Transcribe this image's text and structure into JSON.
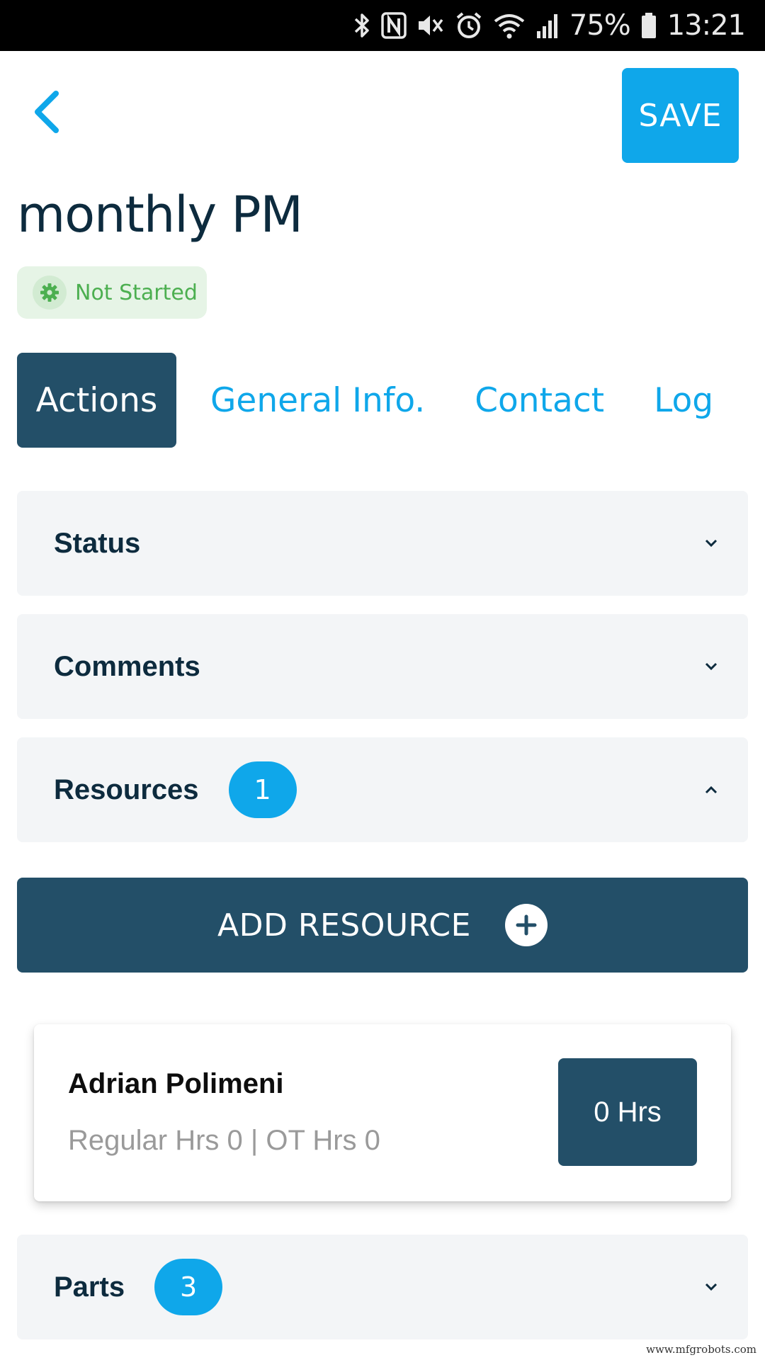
{
  "status_bar": {
    "battery_percent": "75%",
    "time": "13:21",
    "icons": [
      "bluetooth-icon",
      "nfc-icon",
      "mute-icon",
      "alarm-icon",
      "wifi-icon",
      "signal-icon",
      "battery-icon"
    ]
  },
  "header": {
    "back_icon": "chevron-left-icon",
    "save_label": "SAVE"
  },
  "work_order": {
    "title": "monthly PM",
    "status_label": "Not Started",
    "status_icon": "gear-icon"
  },
  "tabs": [
    {
      "label": "Actions",
      "active": true
    },
    {
      "label": "General Info.",
      "active": false
    },
    {
      "label": "Contact",
      "active": false
    },
    {
      "label": "Log",
      "active": false
    }
  ],
  "sections": {
    "status": {
      "label": "Status",
      "expanded": false
    },
    "comments": {
      "label": "Comments",
      "expanded": false
    },
    "resources": {
      "label": "Resources",
      "count": "1",
      "expanded": true
    },
    "parts": {
      "label": "Parts",
      "count": "3",
      "expanded": false
    }
  },
  "add_resource": {
    "label": "ADD RESOURCE",
    "icon": "plus-circle-icon"
  },
  "resources": [
    {
      "name": "Adrian Polimeni",
      "detail": "Regular Hrs 0 | OT Hrs 0",
      "hours_label": "0 Hrs"
    }
  ],
  "watermark": "www.mfgrobots.com",
  "colors": {
    "accent": "#0fa7ea",
    "primary_dark": "#234f68",
    "title_text": "#0d2b3e",
    "status_green": "#4caf50",
    "status_bg": "#e6f4e6",
    "panel_bg": "#f3f5f7"
  }
}
